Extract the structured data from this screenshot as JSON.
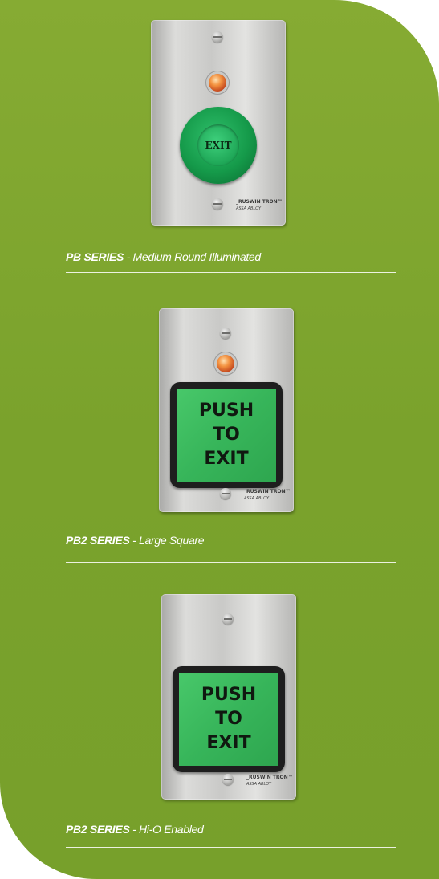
{
  "products": [
    {
      "series": "PB SERIES",
      "separator": " - ",
      "description": "Medium Round Illuminated",
      "button_text": "EXIT",
      "brand_name": "_RUSWIN TRON™",
      "brand_sub": "ASSA ABLOY"
    },
    {
      "series": "PB2 SERIES",
      "separator": " - ",
      "description": "Large Square",
      "button_lines": [
        "PUSH",
        "TO",
        "EXIT"
      ],
      "brand_name": "_RUSWIN TRON™",
      "brand_sub": "ASSA ABLOY"
    },
    {
      "series": "PB2 SERIES",
      "separator": " - ",
      "description": "Hi-O Enabled",
      "button_lines": [
        "PUSH",
        "TO",
        "EXIT"
      ],
      "brand_name": "_RUSWIN TRON™",
      "brand_sub": "ASSA ABLOY"
    }
  ],
  "colors": {
    "panel_green": "#7fa62f",
    "button_green": "#37b55a",
    "led_orange": "#f39240",
    "caption_white": "#ffffff"
  }
}
